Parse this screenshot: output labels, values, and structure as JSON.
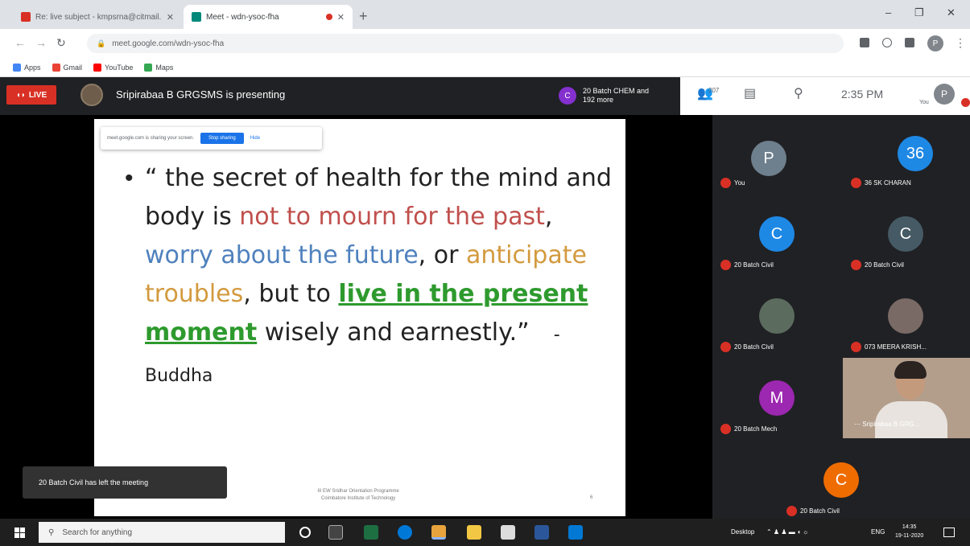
{
  "browser": {
    "tabs": [
      {
        "title": "Re: live subject - kmpsrna@citmail..."
      },
      {
        "title": "Meet - wdn-ysoc-fha"
      }
    ],
    "new_tab": "+",
    "window_controls": [
      "–",
      "❐",
      "✕"
    ],
    "url": "meet.google.com/wdn-ysoc-fha",
    "bookmarks": [
      "Apps",
      "Gmail",
      "YouTube",
      "Maps"
    ]
  },
  "meet": {
    "live_label": "LIVE",
    "presenting_text": "Sripirabaa B GRGSMS is presenting",
    "participants_chip": {
      "initial": "C",
      "text": "20 Batch CHEM and 192 more"
    },
    "participant_count": "207",
    "time": "2:35 PM",
    "you_initial": "P",
    "you_label": "You",
    "share_bar": {
      "text": "meet.google.com is sharing your screen.",
      "stop": "Stop sharing",
      "hide": "Hide"
    },
    "toast": "20 Batch Civil has left the meeting"
  },
  "slide": {
    "bullet": "•",
    "segments": {
      "s1": "“ the secret of health for the mind and body is ",
      "s2": "not to mourn for the past",
      "s3": ", ",
      "s4": "worry about the future",
      "s5": ", or ",
      "s6": "anticipate troubles",
      "s7": ", but to ",
      "s8": "live in the present moment",
      "s9": " wisely and earnestly.”",
      "author": "- Buddha"
    },
    "footer_line1": "III EW Sridhar Orientation Programme",
    "footer_line2": "Coimbatore Institute of Technology",
    "page": "6"
  },
  "participants": [
    {
      "initial": "P",
      "name": "You",
      "color": "#6e7f8d"
    },
    {
      "initial": "36",
      "name": "36 SK CHARAN",
      "color": "#1e88e5"
    },
    {
      "initial": "C",
      "name": "20 Batch Civil",
      "color": "#1e88e5"
    },
    {
      "initial": "C",
      "name": "20 Batch Civil",
      "color": "#455a64"
    },
    {
      "initial": "",
      "name": "20 Batch Civil",
      "color": "#5b6b5e"
    },
    {
      "initial": "",
      "name": "073 MEERA KRISH...",
      "color": "#7a6a66"
    },
    {
      "initial": "M",
      "name": "20 Batch Mech",
      "color": "#9c27b0"
    },
    {
      "initial": "C",
      "name": "20 Batch Civil",
      "color": "#ef6c00"
    }
  ],
  "video_tile": {
    "name": "Sripirabaa B GRG..."
  },
  "taskbar": {
    "search_placeholder": "Search for anything",
    "tray_desktop": "Desktop",
    "tray_lang": "ENG",
    "clock_time": "14:35",
    "clock_date": "19-11-2020"
  }
}
